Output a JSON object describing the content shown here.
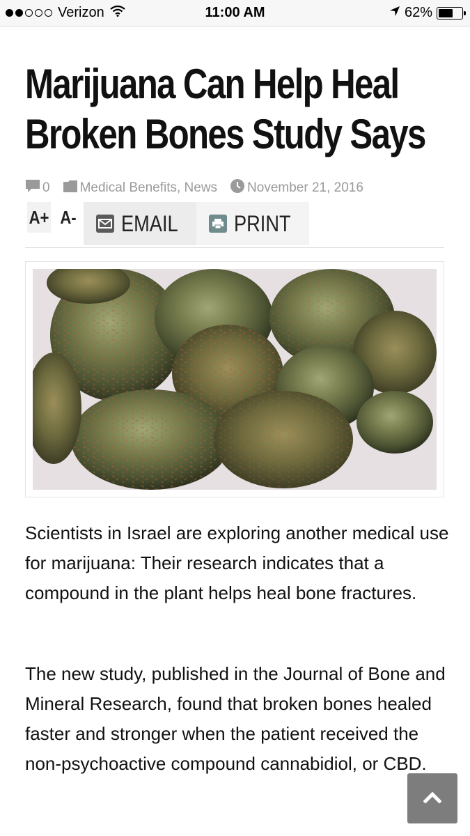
{
  "status_bar": {
    "carrier": "Verizon",
    "time": "11:00 AM",
    "battery_pct": "62%",
    "signal_bars_filled": 2,
    "signal_bars_total": 5,
    "battery_level": 0.62
  },
  "article": {
    "title": "Marijuana Can Help Heal Broken Bones Study Says",
    "comments_count": "0",
    "categories": "Medical Benefits, News",
    "date": "November 21, 2016",
    "font_increase_label": "A+",
    "font_decrease_label": "A-",
    "email_label": "EMAIL",
    "print_label": "PRINT",
    "paragraphs": [
      "Scientists in Israel are exploring another medical use for marijuana: Their research indicates that a compound in the plant helps heal bone fractures.",
      "The new study, published in the Journal of Bone and Mineral Research, found that broken bones healed faster and stronger when the patient received the non-psychoactive compound cannabidiol, or CBD."
    ]
  },
  "icons": {
    "comment": "comment-icon",
    "category": "folder-icon",
    "date": "clock-icon",
    "email": "envelope-icon",
    "print": "printer-icon",
    "scroll_top": "chevron-up-icon"
  },
  "colors": {
    "meta_text": "#9a9a9a",
    "scroll_button": "#7d7d7d",
    "icon_box": "#6f8b8c"
  }
}
